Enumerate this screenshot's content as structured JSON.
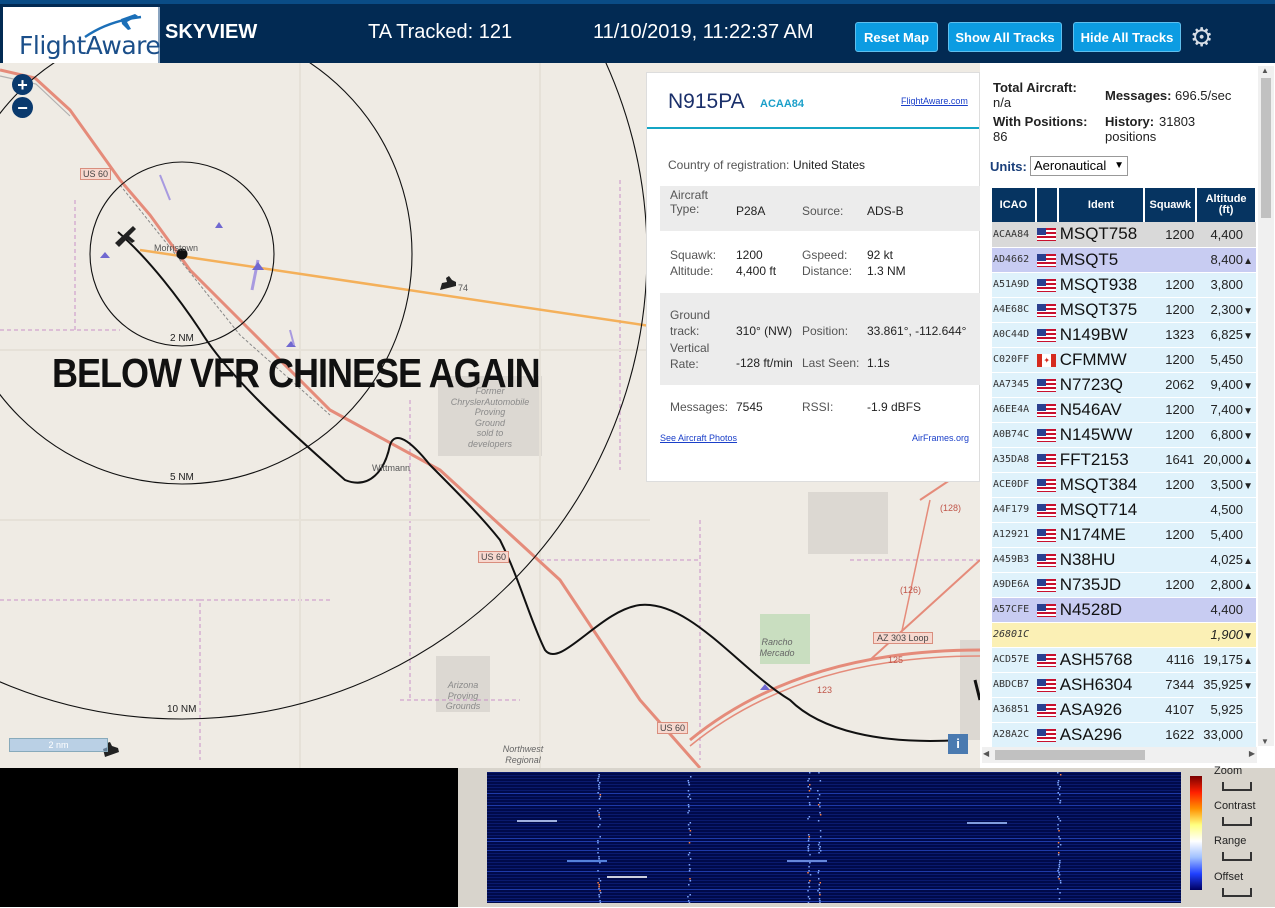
{
  "topbar": {
    "logo_text": "FlightAware",
    "app_name": "SKYVIEW",
    "ta_tracked": "TA Tracked: 121",
    "datetime": "11/10/2019, 11:22:37 AM",
    "reset_map": "Reset Map",
    "show_all": "Show All Tracks",
    "hide_all": "Hide All Tracks",
    "settings_icon": "gear-icon"
  },
  "map": {
    "annotation": "BELOW VFR CHINESE AGAIN",
    "labels": {
      "town1": "Morristown",
      "town2": "Wittmann",
      "chrysler": [
        "Former",
        "ChryslerAutomobile",
        "Proving",
        "Ground",
        "sold to",
        "developers"
      ],
      "arizona": [
        "Arizona",
        "Proving",
        "Grounds"
      ],
      "rancho": [
        "Rancho",
        "Mercado"
      ],
      "northwest": [
        "Northwest",
        "Regional"
      ],
      "us60_a": "US 60",
      "us60_b": "US 60",
      "us60_c": "US 60",
      "loop": "AZ 303 Loop",
      "r123": "123",
      "r125": "125",
      "r126": "(126)",
      "r128": "(128)",
      "r74": "74"
    },
    "range_rings": [
      "2 NM",
      "5 NM",
      "10 NM"
    ],
    "scale": "2 nm",
    "zoom_in": "+",
    "zoom_out": "−"
  },
  "aircraft": {
    "registration": "N915PA",
    "hex": "ACAA84",
    "link": "FlightAware.com",
    "country_label": "Country of registration:",
    "country": "United States",
    "type_label": "Aircraft\nType:",
    "type": "P28A",
    "source_label": "Source:",
    "source": "ADS-B",
    "squawk_label": "Squawk:",
    "squawk": "1200",
    "altitude_label": "Altitude:",
    "altitude": "4,400 ft",
    "gspeed_label": "Gspeed:",
    "gspeed": "92 kt",
    "distance_label": "Distance:",
    "distance": "1.3 NM",
    "track_label": "Ground\ntrack:",
    "track": "310° (NW)",
    "vrate_label": "Vertical\nRate:",
    "vrate": "-128 ft/min",
    "position_label": "Position:",
    "position": "33.861°, -112.644°",
    "lastseen_label": "Last Seen:",
    "lastseen": "1.1s",
    "messages_label": "Messages:",
    "messages": "7545",
    "rssi_label": "RSSI:",
    "rssi": "-1.9 dBFS",
    "photos_link": "See Aircraft Photos",
    "airframes_link": "AirFrames.org"
  },
  "stats": {
    "total_label": "Total Aircraft:",
    "total": "n/a",
    "messages_label": "Messages:",
    "messages": "696.5/sec",
    "positions_label": "With Positions:",
    "positions": "86",
    "history_label": "History:",
    "history": "31803",
    "history_unit": "positions",
    "units_label": "Units:",
    "units_value": "Aeronautical"
  },
  "table": {
    "headers": [
      "ICAO",
      "",
      "Ident",
      "Squawk",
      "Altitude (ft)"
    ],
    "rows": [
      {
        "icao": "ACAA84",
        "flag": "us",
        "ident": "MSQT758",
        "squawk": "1200",
        "alt": "4,400",
        "trend": "",
        "bg": "#d9d9d9"
      },
      {
        "icao": "AD4662",
        "flag": "us",
        "ident": "MSQT5",
        "squawk": "",
        "alt": "8,400",
        "trend": "▲",
        "bg": "#c8ccf2"
      },
      {
        "icao": "A51A9D",
        "flag": "us",
        "ident": "MSQT938",
        "squawk": "1200",
        "alt": "3,800",
        "trend": "",
        "bg": "#dff2fb"
      },
      {
        "icao": "A4E68C",
        "flag": "us",
        "ident": "MSQT375",
        "squawk": "1200",
        "alt": "2,300",
        "trend": "▼",
        "bg": "#dff2fb"
      },
      {
        "icao": "A0C44D",
        "flag": "us",
        "ident": "N149BW",
        "squawk": "1323",
        "alt": "6,825",
        "trend": "▼",
        "bg": "#dff2fb"
      },
      {
        "icao": "C020FF",
        "flag": "ca",
        "ident": "CFMMW",
        "squawk": "1200",
        "alt": "5,450",
        "trend": "",
        "bg": "#dff2fb"
      },
      {
        "icao": "AA7345",
        "flag": "us",
        "ident": "N7723Q",
        "squawk": "2062",
        "alt": "9,400",
        "trend": "▼",
        "bg": "#dff2fb"
      },
      {
        "icao": "A6EE4A",
        "flag": "us",
        "ident": "N546AV",
        "squawk": "1200",
        "alt": "7,400",
        "trend": "▼",
        "bg": "#dff2fb"
      },
      {
        "icao": "A0B74C",
        "flag": "us",
        "ident": "N145WW",
        "squawk": "1200",
        "alt": "6,800",
        "trend": "▼",
        "bg": "#dff2fb"
      },
      {
        "icao": "A35DA8",
        "flag": "us",
        "ident": "FFT2153",
        "squawk": "1641",
        "alt": "20,000",
        "trend": "▲",
        "bg": "#dff2fb"
      },
      {
        "icao": "ACE0DF",
        "flag": "us",
        "ident": "MSQT384",
        "squawk": "1200",
        "alt": "3,500",
        "trend": "▼",
        "bg": "#dff2fb"
      },
      {
        "icao": "A4F179",
        "flag": "us",
        "ident": "MSQT714",
        "squawk": "",
        "alt": "4,500",
        "trend": "",
        "bg": "#dff2fb"
      },
      {
        "icao": "A12921",
        "flag": "us",
        "ident": "N174ME",
        "squawk": "1200",
        "alt": "5,400",
        "trend": "",
        "bg": "#dff2fb"
      },
      {
        "icao": "A459B3",
        "flag": "us",
        "ident": "N38HU",
        "squawk": "",
        "alt": "4,025",
        "trend": "▲",
        "bg": "#dff2fb"
      },
      {
        "icao": "A9DE6A",
        "flag": "us",
        "ident": "N735JD",
        "squawk": "1200",
        "alt": "2,800",
        "trend": "▲",
        "bg": "#dff2fb"
      },
      {
        "icao": "A57CFE",
        "flag": "us",
        "ident": "N4528D",
        "squawk": "",
        "alt": "4,400",
        "trend": "",
        "bg": "#c8ccf2"
      },
      {
        "icao": "26801C",
        "flag": "",
        "ident": "",
        "squawk": "",
        "alt": "1,900",
        "trend": "▼",
        "bg": "#fbf0b5",
        "italic": true
      },
      {
        "icao": "ACD57E",
        "flag": "us",
        "ident": "ASH5768",
        "squawk": "4116",
        "alt": "19,175",
        "trend": "▲",
        "bg": "#dff2fb"
      },
      {
        "icao": "ABDCB7",
        "flag": "us",
        "ident": "ASH6304",
        "squawk": "7344",
        "alt": "35,925",
        "trend": "▼",
        "bg": "#dff2fb"
      },
      {
        "icao": "A36851",
        "flag": "us",
        "ident": "ASA926",
        "squawk": "4107",
        "alt": "5,925",
        "trend": "",
        "bg": "#dff2fb"
      },
      {
        "icao": "A28A2C",
        "flag": "us",
        "ident": "ASA296",
        "squawk": "1622",
        "alt": "33,000",
        "trend": "",
        "bg": "#dff2fb"
      }
    ]
  },
  "waterfall": {
    "zoom": "Zoom",
    "contrast": "Contrast",
    "range": "Range",
    "offset": "Offset"
  }
}
